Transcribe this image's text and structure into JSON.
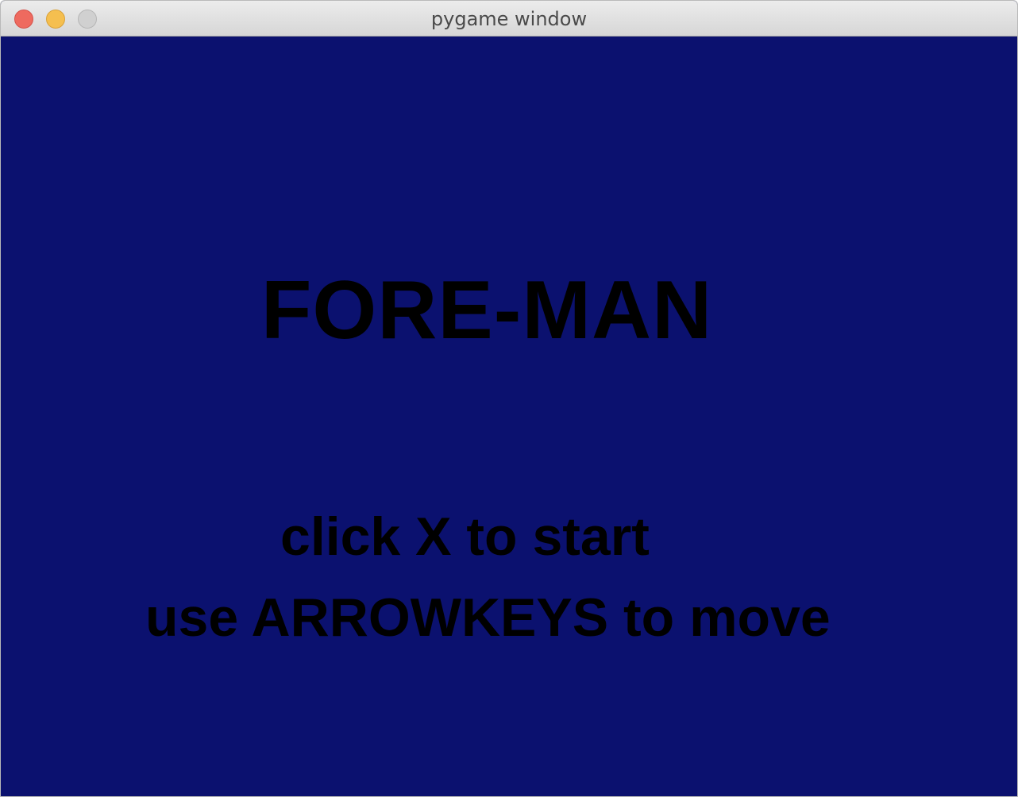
{
  "window": {
    "title": "pygame window"
  },
  "game": {
    "title": "FORE-MAN",
    "instructions": {
      "start": "click X to start",
      "move": "use ARROWKEYS to move"
    },
    "colors": {
      "background": "#0b116f",
      "text": "#000000"
    }
  },
  "titlebar": {
    "buttons": {
      "close": "close-icon",
      "minimize": "minimize-icon",
      "zoom": "zoom-icon"
    }
  }
}
